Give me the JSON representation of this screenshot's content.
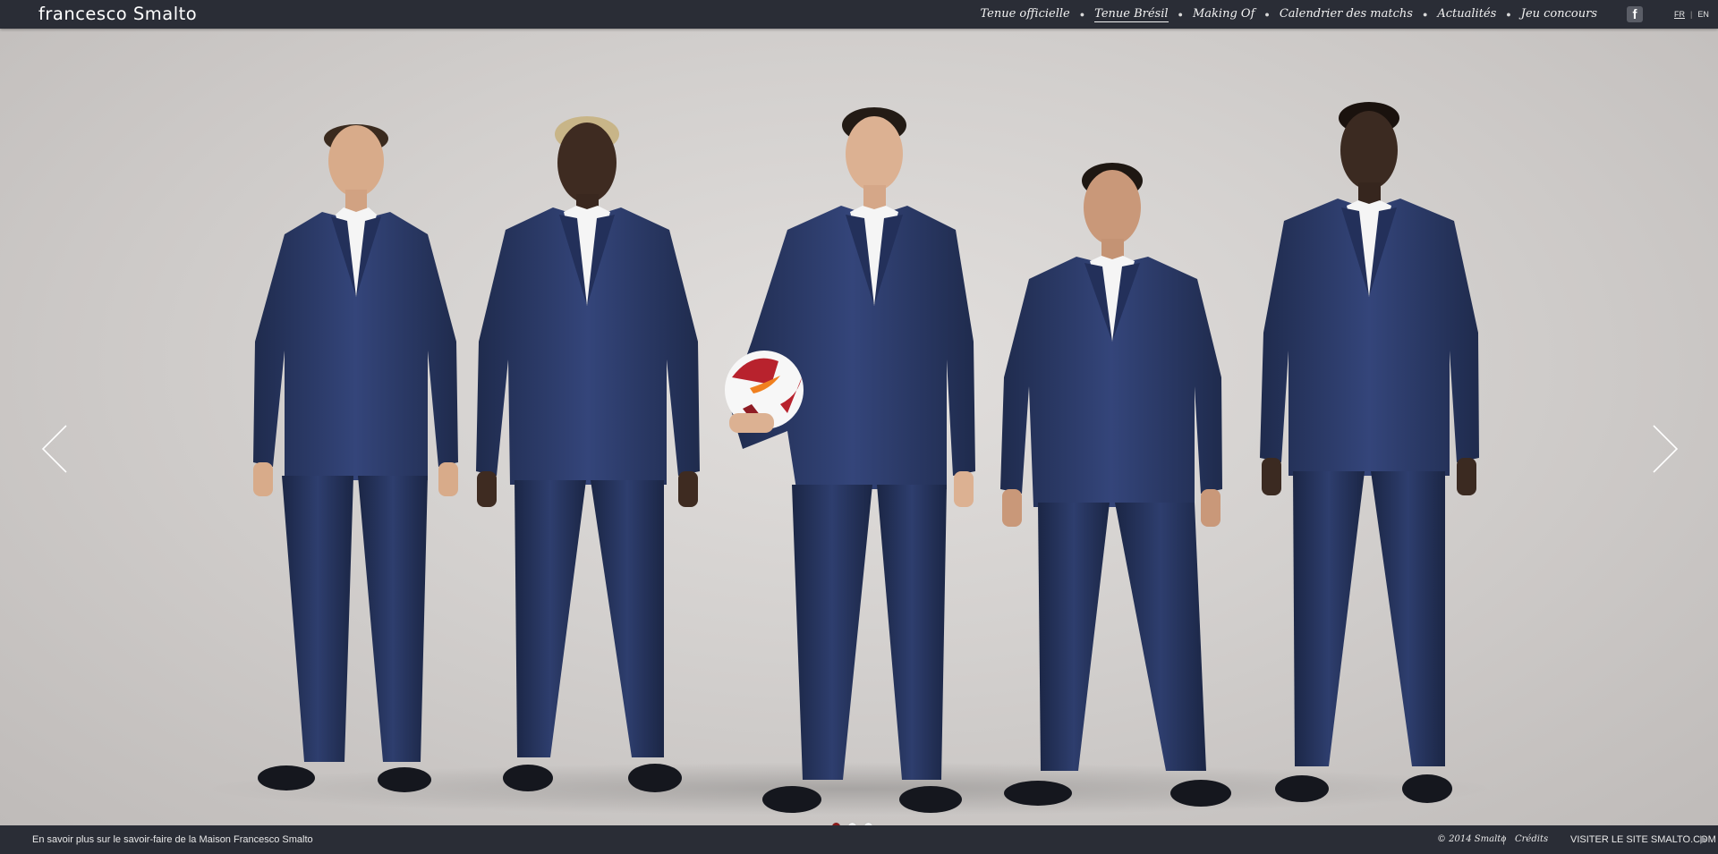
{
  "header": {
    "logo": "francesco Smalto",
    "nav": [
      {
        "label": "Tenue officielle",
        "active": false
      },
      {
        "label": "Tenue Brésil",
        "active": true
      },
      {
        "label": "Making Of",
        "active": false
      },
      {
        "label": "Calendrier des matchs",
        "active": false
      },
      {
        "label": "Actualités",
        "active": false
      },
      {
        "label": "Jeu concours",
        "active": false
      }
    ],
    "facebook_icon": "f",
    "lang": {
      "fr": "FR",
      "separator": "|",
      "en": "EN",
      "active": "FR"
    }
  },
  "slider": {
    "prev_icon": "chevron-left",
    "next_icon": "chevron-right",
    "dots_count": 3,
    "active_dot": 1,
    "image_description_visible": false
  },
  "footer": {
    "left_link": "En savoir plus sur le savoir-faire de la Maison Francesco Smalto",
    "copyright": "© 2014 Smalto",
    "separator": "|",
    "credits": "Crédits",
    "visit": "VISITER LE SITE SMALTO.COM"
  },
  "colors": {
    "bar": "#2a2d36",
    "suit": "#2c3a63",
    "active_dot": "#8b1a1a",
    "background": "#cfccca"
  }
}
